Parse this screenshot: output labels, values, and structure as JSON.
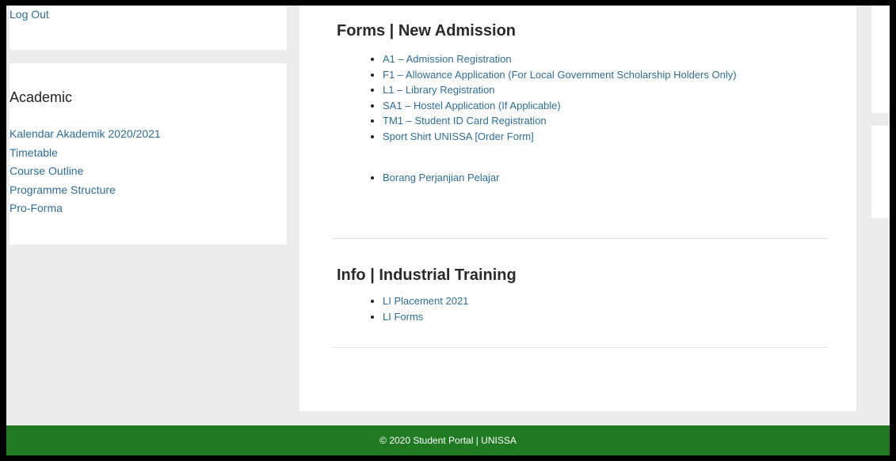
{
  "sidebar": {
    "logout_label": "Log Out",
    "academic_title": "Academic",
    "academic_links": [
      "Kalendar Akademik 2020/2021",
      "Timetable",
      "Course Outline",
      "Programme Structure",
      "Pro-Forma"
    ]
  },
  "forms_section": {
    "title": "Forms | New Admission",
    "items": [
      "A1 – Admission Registration",
      "F1 – Allowance Application (For Local Government Scholarship Holders Only)",
      "L1 – Library Registration",
      "SA1 – Hostel Application (If Applicable)",
      "TM1 – Student ID Card Registration",
      "Sport Shirt UNISSA [Order Form]"
    ],
    "extra_item": "Borang Perjanjian Pelajar"
  },
  "info_section": {
    "title": "Info | Industrial Training",
    "items": [
      "LI Placement 2021",
      "LI Forms"
    ]
  },
  "footer": {
    "text": "© 2020 Student Portal | UNISSA"
  },
  "colors": {
    "link": "#2c6e9a",
    "footer_bg": "#1f7a21",
    "page_bg": "#ececec"
  }
}
